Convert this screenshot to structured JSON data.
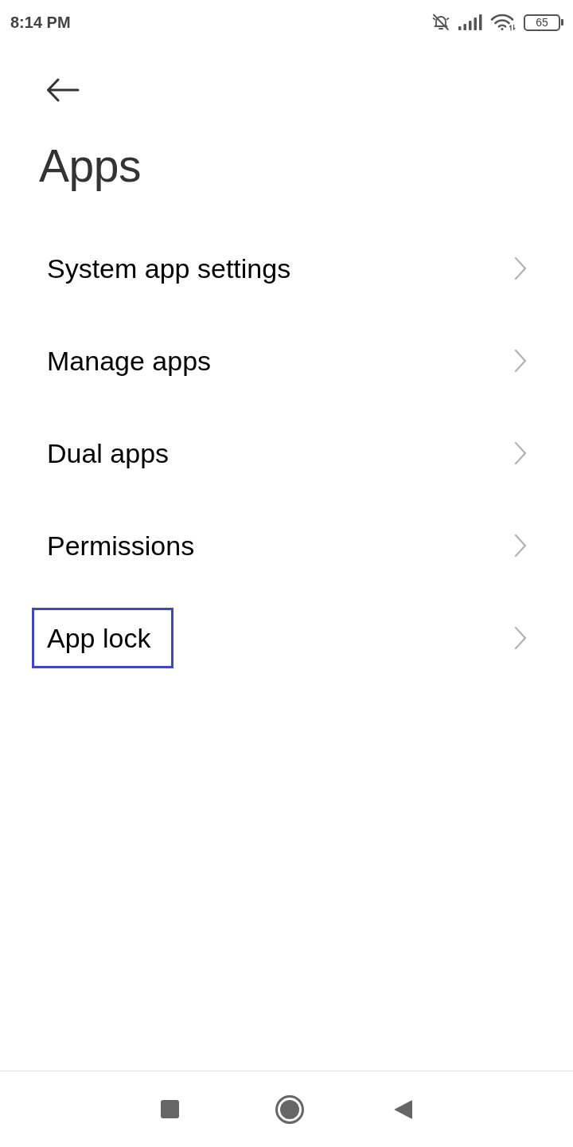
{
  "status_bar": {
    "time": "8:14 PM",
    "battery": "65"
  },
  "header": {
    "title": "Apps"
  },
  "items": [
    {
      "label": "System app settings",
      "highlighted": false
    },
    {
      "label": "Manage apps",
      "highlighted": false
    },
    {
      "label": "Dual apps",
      "highlighted": false
    },
    {
      "label": "Permissions",
      "highlighted": false
    },
    {
      "label": "App lock",
      "highlighted": true
    }
  ]
}
